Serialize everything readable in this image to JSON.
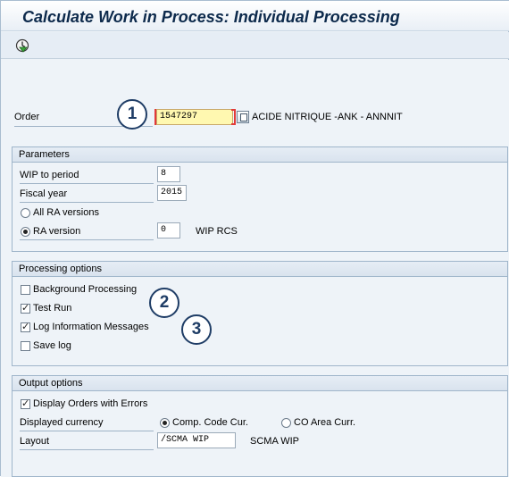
{
  "window": {
    "title": "Calculate Work in Process: Individual Processing"
  },
  "toolbar": {
    "execute_icon": "execute-clock-icon"
  },
  "order": {
    "label": "Order",
    "value": "1547297",
    "description": "ACIDE NITRIQUE -ANK - ANNNIT",
    "match_icon": "matchcode-icon"
  },
  "parameters": {
    "header": "Parameters",
    "wip_to_period": {
      "label": "WIP to period",
      "value": "8"
    },
    "fiscal_year": {
      "label": "Fiscal year",
      "value": "2015"
    },
    "all_ra_versions": {
      "label": "All RA versions",
      "selected": false
    },
    "ra_version": {
      "label": "RA version",
      "value": "0",
      "description": "WIP RCS",
      "selected": true
    }
  },
  "processing": {
    "header": "Processing options",
    "background_processing": {
      "label": "Background Processing",
      "checked": false
    },
    "test_run": {
      "label": "Test Run",
      "checked": true
    },
    "log_info": {
      "label": "Log Information Messages",
      "checked": true
    },
    "save_log": {
      "label": "Save log",
      "checked": false
    }
  },
  "output": {
    "header": "Output options",
    "display_errors": {
      "label": "Display Orders with Errors",
      "checked": true
    },
    "displayed_currency": {
      "label": "Displayed currency",
      "comp_code": {
        "label": "Comp. Code Cur.",
        "selected": true
      },
      "co_area": {
        "label": "CO Area Curr.",
        "selected": false
      }
    },
    "layout": {
      "label": "Layout",
      "value": "/SCMA WIP",
      "description": "SCMA WIP"
    }
  },
  "callouts": [
    "1",
    "2",
    "3"
  ]
}
